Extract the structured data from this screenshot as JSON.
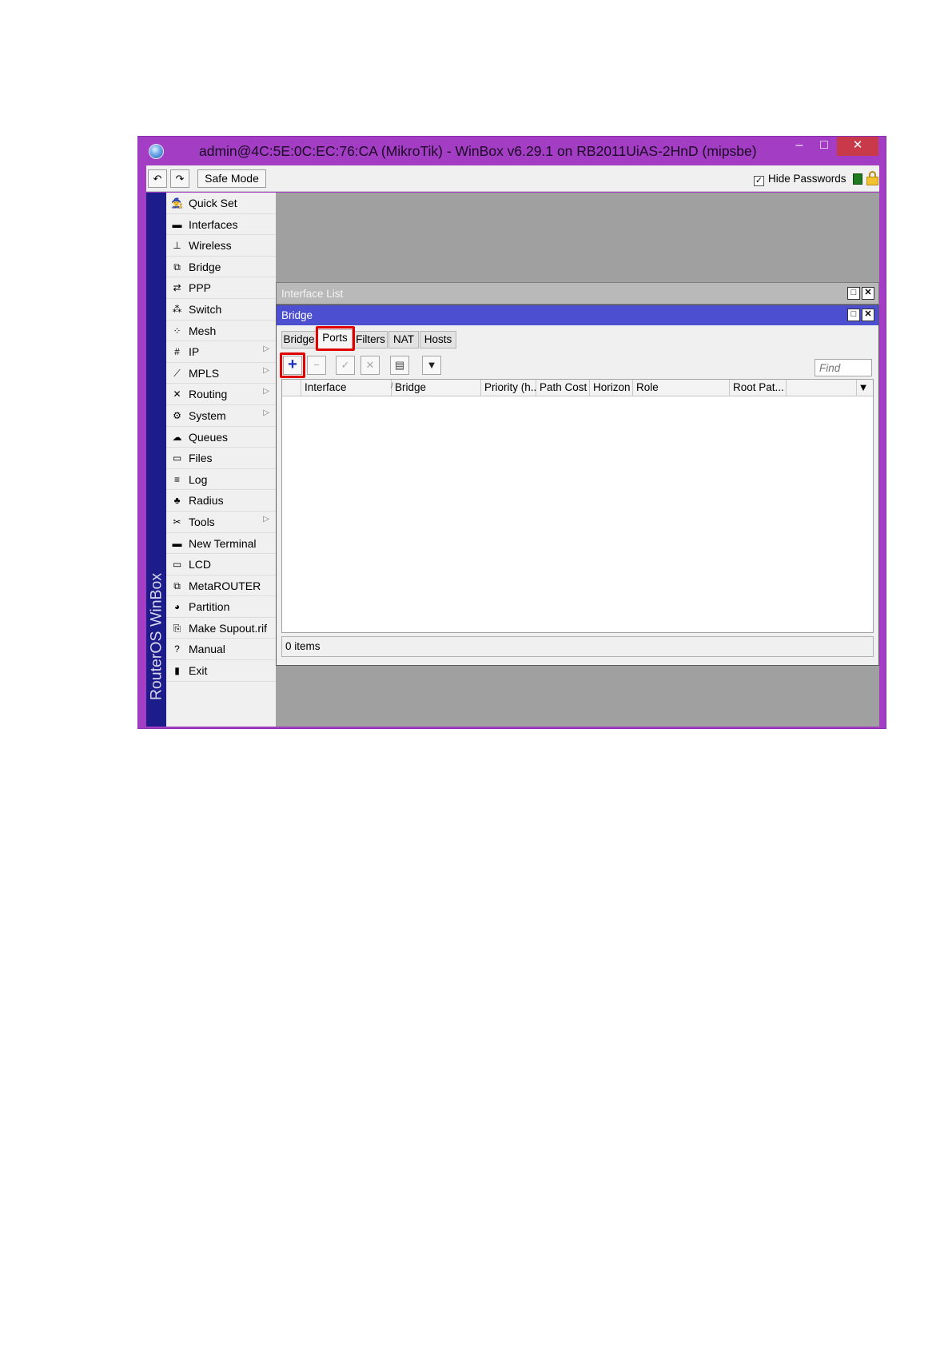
{
  "window": {
    "title": "admin@4C:5E:0C:EC:76:CA (MikroTik) - WinBox v6.29.1 on RB2011UiAS-2HnD (mipsbe)",
    "minimize": "–",
    "maximize": "□",
    "close": "✕"
  },
  "toolbar": {
    "undo": "↶",
    "redo": "↷",
    "safe_mode": "Safe Mode",
    "hide_passwords_label": "Hide Passwords",
    "hide_passwords_checked": "✓"
  },
  "brand": "RouterOS WinBox",
  "sidebar": {
    "items": [
      {
        "label": "Quick Set",
        "icon": "quick-set-icon",
        "glyph": "🧙"
      },
      {
        "label": "Interfaces",
        "icon": "interfaces-icon",
        "glyph": "▬"
      },
      {
        "label": "Wireless",
        "icon": "wireless-icon",
        "glyph": "⊥"
      },
      {
        "label": "Bridge",
        "icon": "bridge-icon",
        "glyph": "⧉"
      },
      {
        "label": "PPP",
        "icon": "ppp-icon",
        "glyph": "⇄"
      },
      {
        "label": "Switch",
        "icon": "switch-icon",
        "glyph": "⁂"
      },
      {
        "label": "Mesh",
        "icon": "mesh-icon",
        "glyph": "⁘"
      },
      {
        "label": "IP",
        "icon": "ip-icon",
        "glyph": "#",
        "arrow": "▷"
      },
      {
        "label": "MPLS",
        "icon": "mpls-icon",
        "glyph": "⟋",
        "arrow": "▷"
      },
      {
        "label": "Routing",
        "icon": "routing-icon",
        "glyph": "✕",
        "arrow": "▷"
      },
      {
        "label": "System",
        "icon": "system-icon",
        "glyph": "⚙",
        "arrow": "▷"
      },
      {
        "label": "Queues",
        "icon": "queues-icon",
        "glyph": "☁"
      },
      {
        "label": "Files",
        "icon": "files-icon",
        "glyph": "▭"
      },
      {
        "label": "Log",
        "icon": "log-icon",
        "glyph": "≡"
      },
      {
        "label": "Radius",
        "icon": "radius-icon",
        "glyph": "♣"
      },
      {
        "label": "Tools",
        "icon": "tools-icon",
        "glyph": "✂",
        "arrow": "▷"
      },
      {
        "label": "New Terminal",
        "icon": "terminal-icon",
        "glyph": "▬"
      },
      {
        "label": "LCD",
        "icon": "lcd-icon",
        "glyph": "▭"
      },
      {
        "label": "MetaROUTER",
        "icon": "metarouter-icon",
        "glyph": "⧉"
      },
      {
        "label": "Partition",
        "icon": "partition-icon",
        "glyph": "◕"
      },
      {
        "label": "Make Supout.rif",
        "icon": "supout-icon",
        "glyph": "⎘"
      },
      {
        "label": "Manual",
        "icon": "manual-icon",
        "glyph": "?"
      },
      {
        "label": "Exit",
        "icon": "exit-icon",
        "glyph": "▮"
      }
    ]
  },
  "interface_list_window": {
    "title": "Interface List",
    "maximize": "□",
    "close": "✕"
  },
  "bridge_window": {
    "title": "Bridge",
    "maximize": "□",
    "close": "✕",
    "tabs": [
      "Bridge",
      "Ports",
      "Filters",
      "NAT",
      "Hosts"
    ],
    "active_tab": "Ports",
    "toolbar": {
      "add": "+",
      "remove": "−",
      "enable": "✓",
      "disable": "✕",
      "comment": "▤",
      "filter": "▼"
    },
    "find_placeholder": "Find",
    "columns": [
      "Interface",
      "Bridge",
      "Priority (h...",
      "Path Cost",
      "Horizon",
      "Role",
      "Root Pat..."
    ],
    "sort_mark": "/",
    "column_menu": "▼",
    "rows": [],
    "status": "0 items"
  },
  "colors": {
    "window_frame": "#a23dc4",
    "close_button": "#c8394a",
    "brand_strip": "#1c1c8a",
    "bridge_titlebar": "#4c4fd0",
    "highlight": "#e00000",
    "desktop": "#a0a0a0"
  }
}
